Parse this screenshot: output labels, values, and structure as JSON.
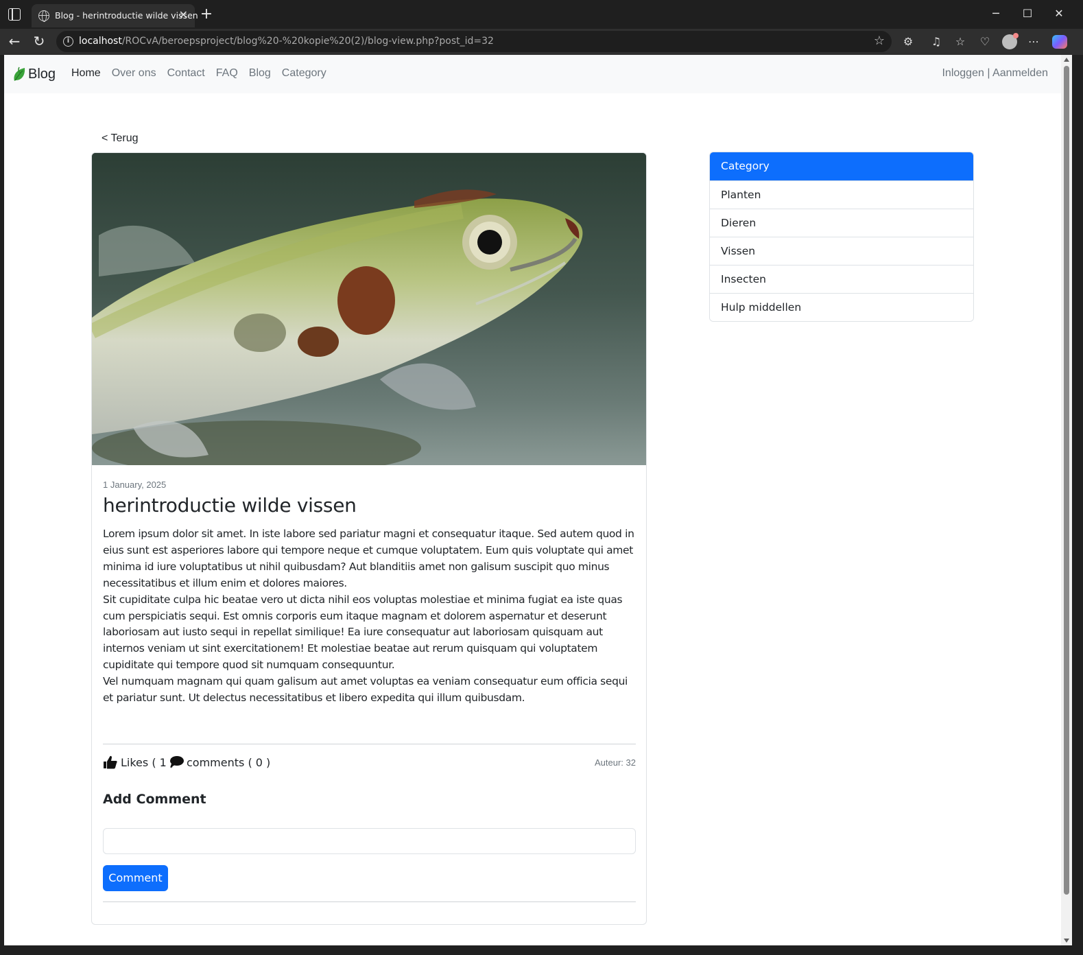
{
  "browser": {
    "tab_title": "Blog - herintroductie wilde vissen",
    "url_host": "localhost",
    "url_path": "/ROCvA/beroepsproject/blog%20-%20kopie%20(2)/blog-view.php?post_id=32"
  },
  "navbar": {
    "brand": "Blog",
    "links": [
      "Home",
      "Over ons",
      "Contact",
      "FAQ",
      "Blog",
      "Category"
    ],
    "login": "Inloggen",
    "separator": " | ",
    "register": "Aanmelden"
  },
  "back_link": "< Terug",
  "post": {
    "date": "1 January, 2025",
    "title": "herintroductie wilde vissen",
    "paragraphs": [
      "Lorem ipsum dolor sit amet. In iste labore sed pariatur magni et consequatur itaque. Sed autem quod in eius sunt est asperiores labore qui tempore neque et cumque voluptatem. Eum quis voluptate qui amet minima id iure voluptatibus ut nihil quibusdam? Aut blanditiis amet non galisum suscipit quo minus necessitatibus et illum enim et dolores maiores.",
      "Sit cupiditate culpa hic beatae vero ut dicta nihil eos voluptas molestiae et minima fugiat ea iste quas cum perspiciatis sequi. Est omnis corporis eum itaque magnam et dolorem aspernatur et deserunt laboriosam aut iusto sequi in repellat similique! Ea iure consequatur aut laboriosam quisquam aut internos veniam ut sint exercitationem! Et molestiae beatae aut rerum quisquam qui voluptatem cupiditate qui tempore quod sit numquam consequuntur.",
      "Vel numquam magnam qui quam galisum aut amet voluptas ea veniam consequatur eum officia sequi et pariatur sunt. Ut delectus necessitatibus et libero expedita qui illum quibusdam."
    ],
    "likes_label": "Likes ( 1 )",
    "comments_label": "comments ( 0 )",
    "author": "Auteur: 32",
    "add_comment_title": "Add Comment",
    "comment_placeholder": "",
    "comment_button": "Comment"
  },
  "sidebar": {
    "header": "Category",
    "items": [
      "Planten",
      "Dieren",
      "Vissen",
      "Insecten",
      "Hulp middellen"
    ]
  },
  "colors": {
    "primary": "#0d6efd",
    "navbar_bg": "#f8f9fa",
    "muted_text": "#6c757d",
    "body_text": "#212529"
  }
}
